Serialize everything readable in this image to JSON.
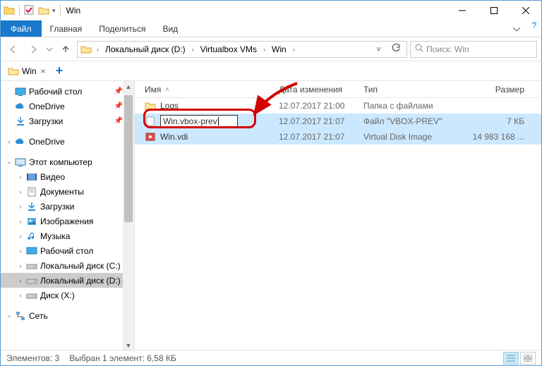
{
  "window": {
    "title": "Win"
  },
  "qat": {
    "dropdown": "▾"
  },
  "ribbon": {
    "file": "Файл",
    "tabs": [
      "Главная",
      "Поделиться",
      "Вид"
    ]
  },
  "breadcrumbs": [
    "Локальный диск (D:)",
    "Virtualbox VMs",
    "Win"
  ],
  "search": {
    "placeholder": "Поиск: Win"
  },
  "foldertab": {
    "label": "Win"
  },
  "columns": {
    "name": "Имя",
    "date": "Дата изменения",
    "type": "Тип",
    "size": "Размер"
  },
  "files": [
    {
      "name": "Logs",
      "date": "12.07.2017 21:00",
      "type": "Папка с файлами",
      "size": ""
    },
    {
      "name": "Win.vbox-prev",
      "date": "12.07.2017 21:07",
      "type": "Файл \"VBOX-PREV\"",
      "size": "7 КБ"
    },
    {
      "name": "Win.vdi",
      "date": "12.07.2017 21:07",
      "type": "Virtual Disk Image",
      "size": "14 983 168 ..."
    }
  ],
  "tree": {
    "quick": [
      {
        "label": "Рабочий стол",
        "pinned": true
      },
      {
        "label": "OneDrive",
        "pinned": true
      },
      {
        "label": "Загрузки",
        "pinned": true
      }
    ],
    "onedrive": "OneDrive",
    "thispc": {
      "label": "Этот компьютер",
      "children": [
        "Видео",
        "Документы",
        "Загрузки",
        "Изображения",
        "Музыка",
        "Рабочий стол",
        "Локальный диск (С:)",
        "Локальный диск (D:)",
        "Диск (X:)"
      ],
      "selected_index": 7
    },
    "network": "Сеть"
  },
  "status": {
    "count": "Элементов: 3",
    "selection": "Выбран 1 элемент: 6,58 КБ"
  },
  "colors": {
    "accent": "#1979ca",
    "selection": "#cce8ff",
    "highlight": "#d40000"
  }
}
